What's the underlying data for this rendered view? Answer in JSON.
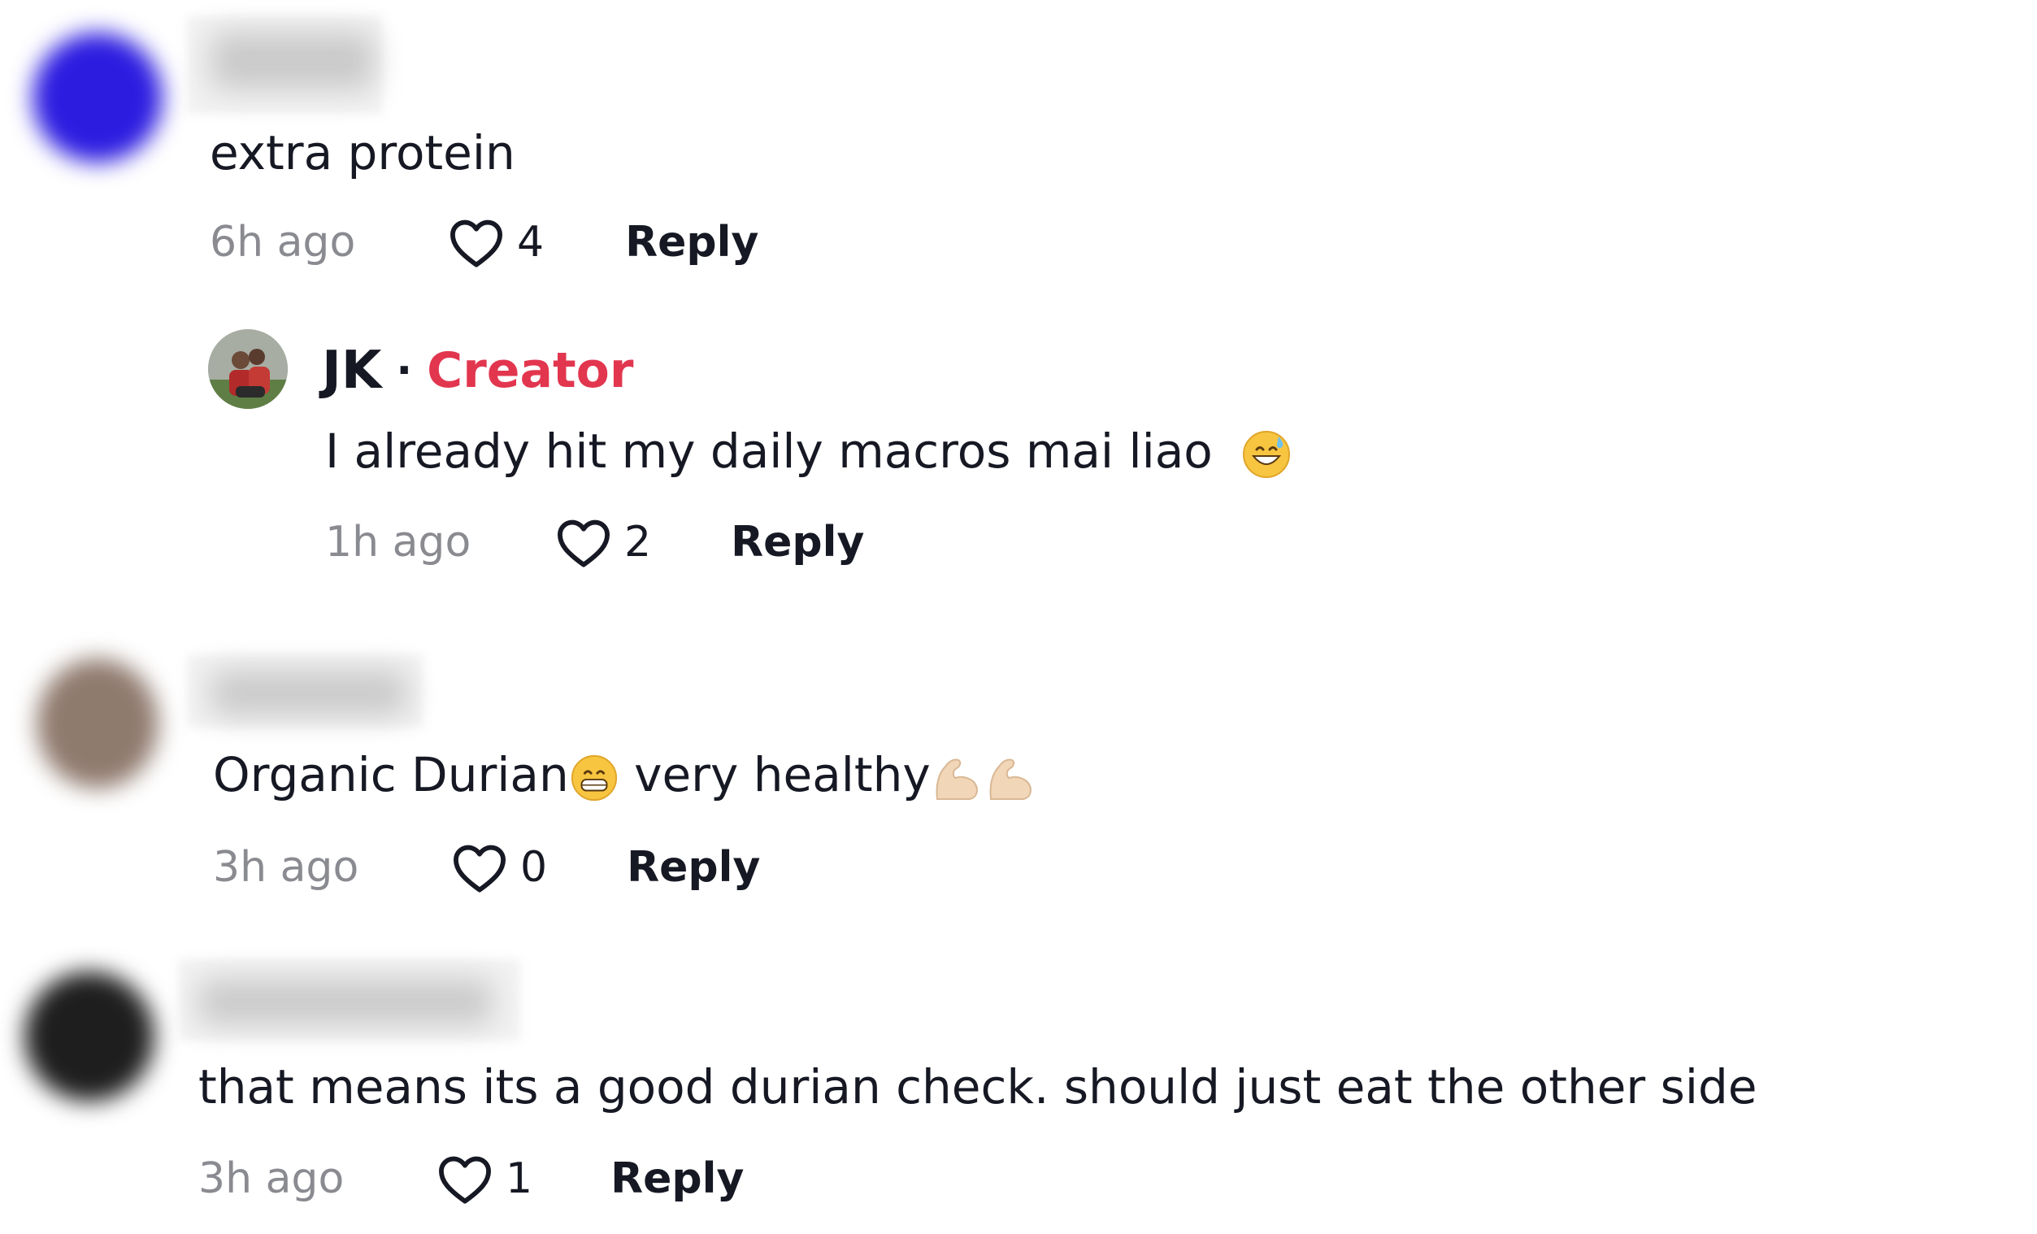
{
  "comments": [
    {
      "text": "extra protein",
      "time": "6h ago",
      "likes": "4",
      "reply_label": "Reply",
      "avatar_color": "#2c1ce0"
    },
    {
      "is_creator": true,
      "name": "JK",
      "separator": "·",
      "badge": "Creator",
      "badge_color": "#e2364f",
      "text": "I already hit my daily macros mai liao",
      "emoji": "grinning-face-with-sweat-emoji",
      "time": "1h ago",
      "likes": "2",
      "reply_label": "Reply"
    },
    {
      "text_part1": "Organic Durian",
      "emoji1": "grimacing-face-emoji",
      "text_part2": " very healthy",
      "emoji2": "flexed-biceps-emoji",
      "time": "3h ago",
      "likes": "0",
      "reply_label": "Reply",
      "avatar_color": "#8f7a6e"
    },
    {
      "text": "that means its a good durian check. should just eat the other side",
      "time": "3h ago",
      "likes": "1",
      "reply_label": "Reply",
      "avatar_color": "#1e1e1e"
    }
  ]
}
